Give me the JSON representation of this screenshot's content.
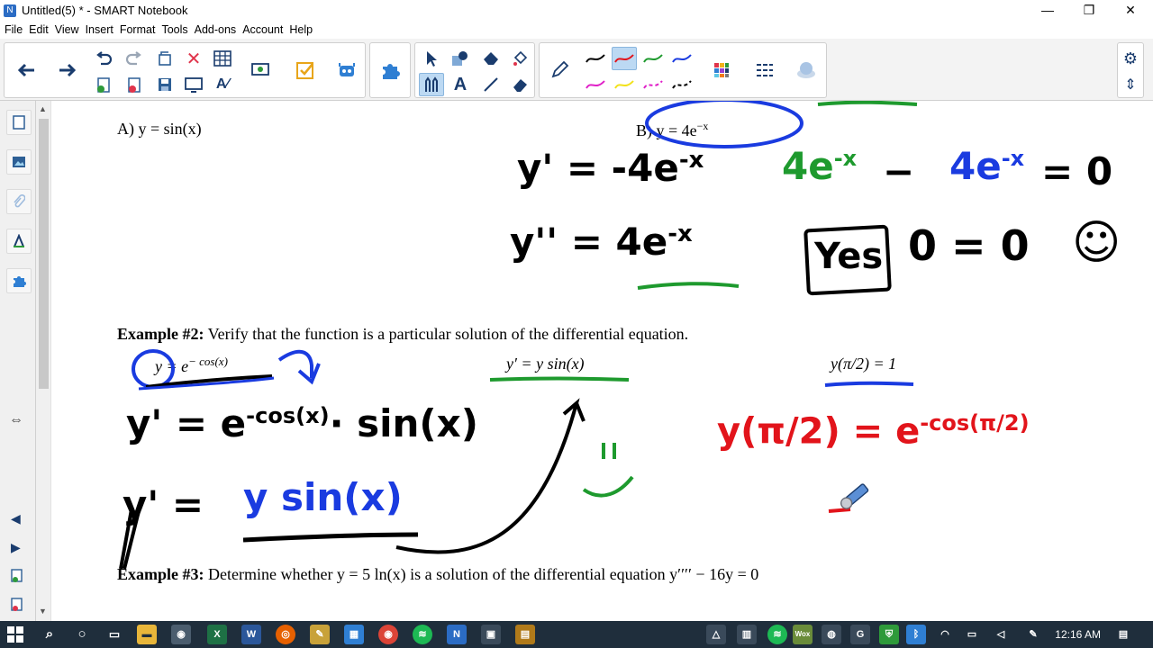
{
  "window": {
    "title": "Untitled(5) * - SMART Notebook",
    "controls": [
      "—",
      "❐",
      "✕"
    ]
  },
  "menu": [
    "File",
    "Edit",
    "View",
    "Insert",
    "Format",
    "Tools",
    "Add-ons",
    "Account",
    "Help"
  ],
  "page": {
    "option_a": "A) y = sin(x)",
    "option_b": "B) y = 4e",
    "option_b_exp": "−x",
    "example2_label": "Example #2:",
    "example2_text": " Verify that the function is a particular solution of the differential equation.",
    "func2": "y = e",
    "func2_exp": "− cos(x)",
    "de2": "y′ = y sin(x)",
    "ic2": "y(π/2) = 1",
    "example3_label": "Example #3:",
    "example3_text": " Determine whether y = 5 ln(x) is a solution of the differential equation y′′′′ − 16y = 0"
  },
  "ink": {
    "b_line1": "y' = -4e",
    "b_line1_exp": "-x",
    "b_line2": "y'' = 4e",
    "b_line2_exp": "-x",
    "check_green": "4e",
    "check_green_exp": "-x",
    "check_minus": "−",
    "check_blue": "4e",
    "check_blue_exp": "-x",
    "check_eq": "= 0",
    "yes": "Yes",
    "zero_eq": "0 = 0",
    "smile": "☺",
    "e2_line1": "y' = e",
    "e2_line1_exp": "-cos(x)",
    "e2_line1_tail": "· sin(x)",
    "e2_line2a": "y' =",
    "e2_line2b": "y sin(x)",
    "eq_mark": "=",
    "red_line": "y(π/2) = e",
    "red_exp": "-cos(π/2)"
  },
  "clock": {
    "time": "12:16 AM"
  },
  "colors": {
    "green_ink": "#1e9a2e",
    "blue_ink": "#1a3be0",
    "red_ink": "#e2141b",
    "black_ink": "#000000"
  }
}
